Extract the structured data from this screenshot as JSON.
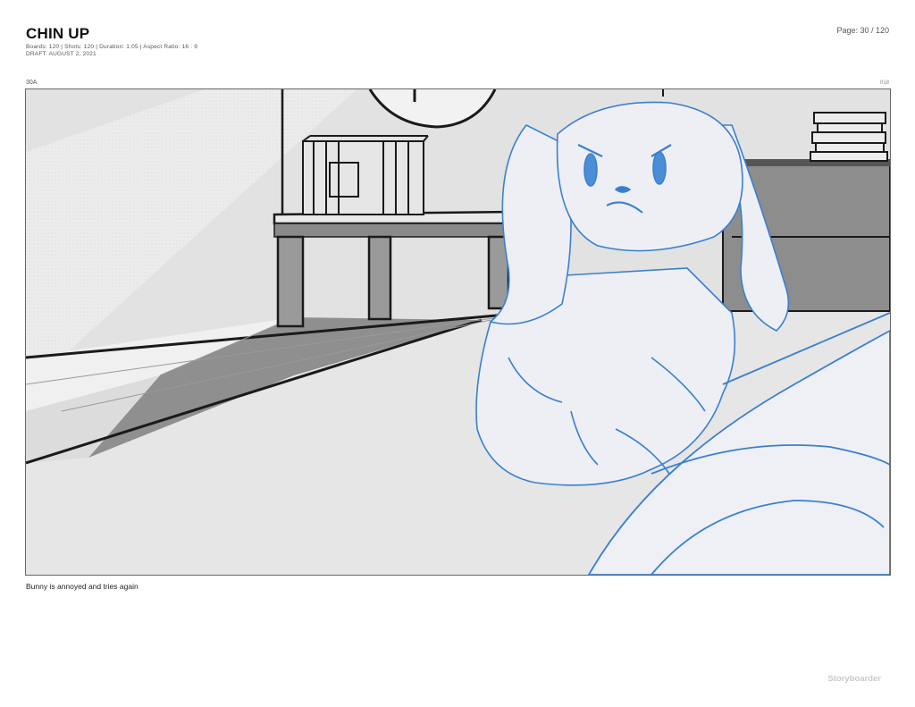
{
  "header": {
    "title": "CHIN UP",
    "meta_line1": "Boards: 120  |  Shots: 120  |  Duration: 1:05  |  Aspect Ratio: 16 : 9",
    "meta_line2": "DRAFT: AUGUST 2, 2021",
    "page": "Page: 30 / 120"
  },
  "board": {
    "shot": "30A",
    "number": "018",
    "caption": "Bunny is annoyed and tries again"
  },
  "footer": {
    "brand": "Storyboarder"
  },
  "colors": {
    "sketch_blue": "#3a7fcf",
    "ink": "#222222",
    "background_grey": "#e4e4e4"
  }
}
